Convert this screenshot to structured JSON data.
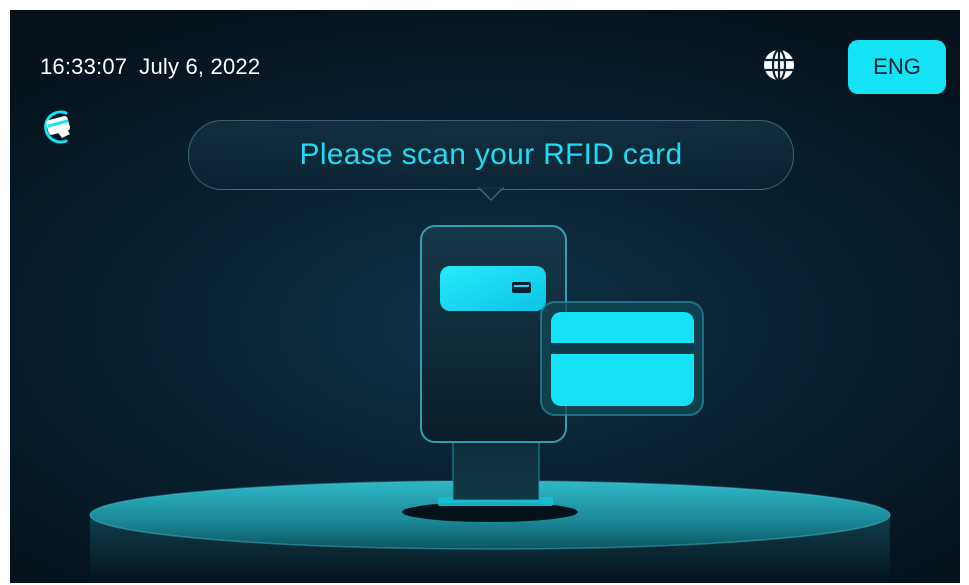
{
  "status_bar": {
    "time": "16:33:07",
    "date": "July 6, 2022",
    "language_label": "ENG",
    "globe_icon": "globe-icon",
    "card_icon": "card-swipe-icon"
  },
  "prompt": {
    "message": "Please scan your RFID card"
  },
  "colors": {
    "accent": "#14e3f6",
    "prompt_text": "#1fdcf2",
    "background": "#0a2232"
  }
}
